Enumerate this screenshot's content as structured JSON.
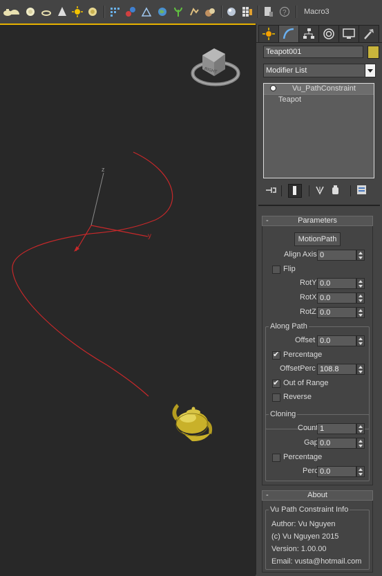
{
  "toolbar": {
    "icons": [
      "teapot-icon",
      "sphere-icon",
      "dome-icon",
      "cylinder-icon",
      "cone-icon",
      "sun-icon",
      "light-bulb-icon",
      "grid-snap-icon",
      "hierarchy-icon",
      "transform-icon",
      "globe-icon",
      "plant-icon",
      "hand-icon",
      "material-icon",
      "render-sphere-icon",
      "grid-icon",
      "document-icon",
      "help-icon"
    ],
    "macro_label": "Macro3"
  },
  "viewport": {
    "axis_labels": {
      "z": "z",
      "y": "y"
    },
    "viewcube_label": "RIGHT",
    "colors": {
      "path": "#c8282a",
      "teapot": "#c9b12a",
      "active_border": "#e8b300"
    }
  },
  "command_panel": {
    "object_name": "Teapot001",
    "object_color": "#c8b43c",
    "modifier_list_label": "Modifier List",
    "stack": [
      {
        "label": "Vu_PathConstraint",
        "selected": true
      },
      {
        "label": "Teapot",
        "selected": false
      }
    ],
    "tabs": [
      "create-tab",
      "modify-tab",
      "hierarchy-tab",
      "motion-tab",
      "display-tab",
      "utilities-tab"
    ],
    "stack_tools": [
      "pin-stack-icon",
      "show-end-result-icon",
      "make-unique-icon",
      "remove-modifier-icon",
      "configure-modifier-sets-icon"
    ]
  },
  "parameters": {
    "title": "Parameters",
    "minus": "-",
    "motion_path_button": "MotionPath",
    "align_axis_label": "Align Axis",
    "align_axis_value": "0",
    "flip_label": "Flip",
    "flip_checked": false,
    "roty_label": "RotY",
    "roty_value": "0.0",
    "rotx_label": "RotX",
    "rotx_value": "0.0",
    "rotz_label": "RotZ",
    "rotz_value": "0.0",
    "along_path": {
      "title": "Along Path",
      "offset_label": "Offset",
      "offset_value": "0.0",
      "percentage_label": "Percentage",
      "percentage_checked": true,
      "offsetperc_label": "OffsetPerc",
      "offsetperc_value": "108.8",
      "out_of_range_label": "Out of Range",
      "out_of_range_checked": true,
      "reverse_label": "Reverse",
      "reverse_checked": false
    },
    "cloning": {
      "title": "Cloning",
      "count_label": "Count",
      "count_value": "1",
      "gap_label": "Gap",
      "gap_value": "0.0",
      "percentage_label": "Percentage",
      "percentage_checked": false,
      "perc_label": "Perc",
      "perc_value": "0.0"
    }
  },
  "about": {
    "title": "About",
    "minus": "-",
    "group_title": "Vu Path Constraint Info",
    "author": "Author: Vu Nguyen",
    "copyright": "(c) Vu Nguyen 2015",
    "version": "Version: 1.00.00",
    "email": "Email: vusta@hotmail.com"
  }
}
